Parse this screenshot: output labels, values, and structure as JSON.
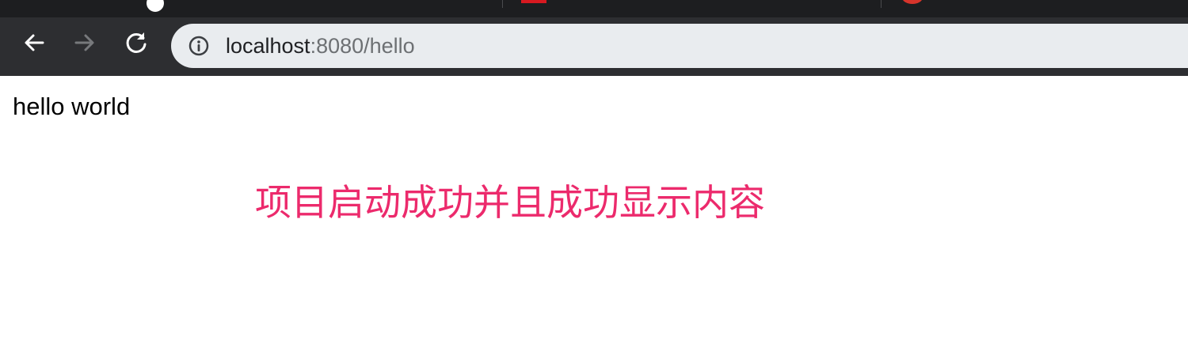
{
  "browser": {
    "address_bar": {
      "host": "localhost",
      "port_and_path": ":8080/hello"
    },
    "icons": {
      "back": "arrow-left-icon",
      "forward": "arrow-right-icon",
      "reload": "reload-icon",
      "site_info": "info-icon"
    }
  },
  "page": {
    "body_text": "hello world"
  },
  "annotation": {
    "text": "项目启动成功并且成功显示内容",
    "color": "#ec2a6c"
  }
}
